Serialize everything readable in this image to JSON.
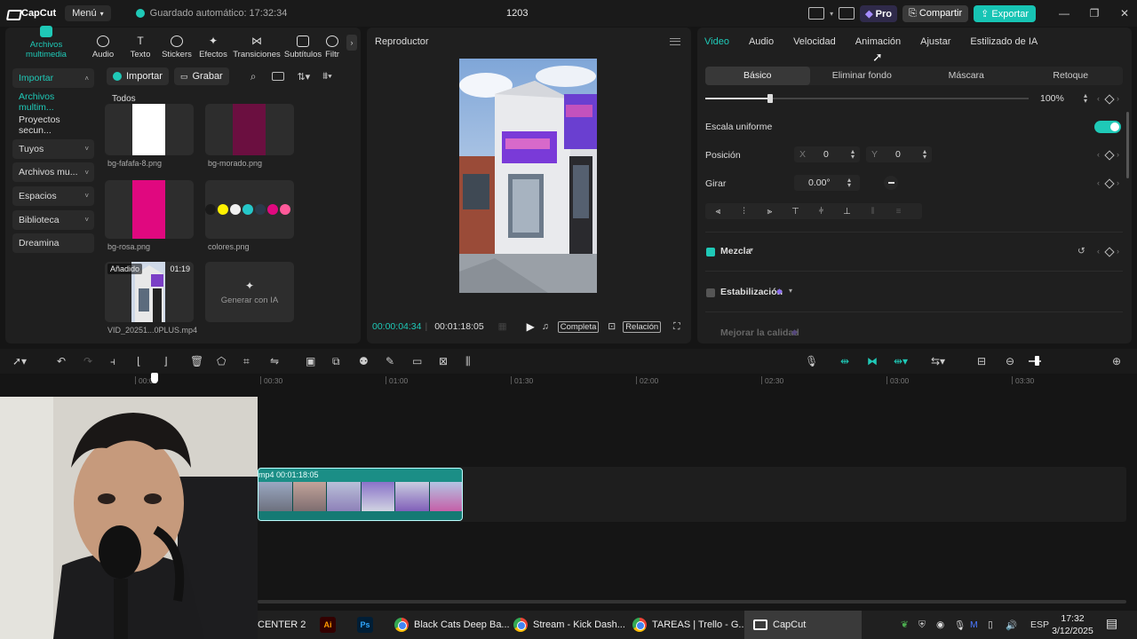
{
  "titlebar": {
    "brand": "CapCut",
    "menu_label": "Menú",
    "autosave": "Guardado automático: 17:32:34",
    "project_title": "1203",
    "pro_label": "Pro",
    "share_label": "Compartir",
    "export_label": "Exportar"
  },
  "media": {
    "tabs": [
      {
        "label": "Archivos multimedia",
        "icon": "media-icon"
      },
      {
        "label": "Audio",
        "icon": "audio-icon"
      },
      {
        "label": "Texto",
        "icon": "text-icon"
      },
      {
        "label": "Stickers",
        "icon": "sticker-icon"
      },
      {
        "label": "Efectos",
        "icon": "effects-icon"
      },
      {
        "label": "Transiciones",
        "icon": "transitions-icon"
      },
      {
        "label": "Subtítulos",
        "icon": "subtitles-icon"
      },
      {
        "label": "Filtr",
        "icon": "filters-icon"
      }
    ],
    "nav": [
      {
        "label": "Importar"
      },
      {
        "label": "Archivos multim..."
      },
      {
        "label": "Proyectos secun..."
      },
      {
        "label": "Tuyos"
      },
      {
        "label": "Archivos mu..."
      },
      {
        "label": "Espacios"
      },
      {
        "label": "Biblioteca"
      },
      {
        "label": "Dreamina"
      }
    ],
    "import_btn": "Importar",
    "record_btn": "Grabar",
    "filter_label": "Todos",
    "items": [
      {
        "name": "bg-fafafa-8.png",
        "color": "#ffffff"
      },
      {
        "name": "bg-morado.png",
        "color": "#6b0f40"
      },
      {
        "name": "bg-rosa.png",
        "color": "#e0087f"
      },
      {
        "name": "colores.png",
        "palette": [
          "#1a1a1a",
          "#fff100",
          "#f0f0f0",
          "#25c7c9",
          "#2a3a4a",
          "#e0087f",
          "#ff5a9a"
        ]
      },
      {
        "name": "VID_20251...0PLUS.mp4",
        "badge": "Añadido",
        "duration": "01:19"
      }
    ],
    "generate_ai": "Generar con IA"
  },
  "player": {
    "title": "Reproductor",
    "current_time": "00:00:04:34",
    "total_time": "00:01:18:05",
    "full_label": "Completa",
    "ratio_label": "Relación"
  },
  "inspector": {
    "tabs": [
      "Video",
      "Audio",
      "Velocidad",
      "Animación",
      "Ajustar",
      "Estilizado de IA"
    ],
    "subtabs": [
      "Básico",
      "Eliminar fondo",
      "Máscara",
      "Retoque"
    ],
    "scale_value": "100%",
    "scale_fraction": 0.2,
    "uniform_scale": "Escala uniforme",
    "position_label": "Posición",
    "x_label": "X",
    "x_value": "0",
    "y_label": "Y",
    "y_value": "0",
    "rotate_label": "Girar",
    "rotate_value": "0.00°",
    "blend_label": "Mezcla",
    "stabilize_label": "Estabilización",
    "enhance_label": "Mejorar la calidad"
  },
  "timeline": {
    "ticks": [
      "00:00",
      "00:30",
      "01:00",
      "01:30",
      "02:00",
      "02:30",
      "03:00",
      "03:30"
    ],
    "clip_label": "mp4  00:01:18:05"
  },
  "taskbar": {
    "items": [
      {
        "label": "CENTER 2"
      },
      {
        "label": "Ai",
        "color": "#ff9a00"
      },
      {
        "label": "Ps",
        "color": "#31a8ff"
      },
      {
        "label": "Black Cats Deep Ba..."
      },
      {
        "label": "Stream - Kick Dash..."
      },
      {
        "label": "TAREAS | Trello - G..."
      },
      {
        "label": "CapCut"
      }
    ],
    "lang": "ESP",
    "time": "17:32",
    "date": "3/12/2025"
  },
  "colors": {
    "accent": "#1fc9b7",
    "export": "#17c4b4"
  }
}
